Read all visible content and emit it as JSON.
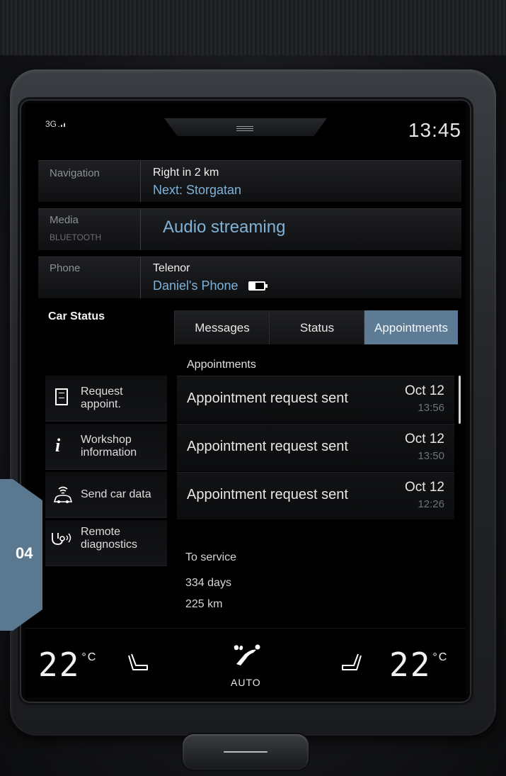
{
  "status_bar": {
    "signal": "3G",
    "clock": "13:45"
  },
  "navigation": {
    "label": "Navigation",
    "instruction": "Right in 2 km",
    "next": "Next: Storgatan"
  },
  "media": {
    "label": "Media",
    "source": "BLUETOOTH",
    "title": "Audio streaming"
  },
  "phone": {
    "label": "Phone",
    "carrier": "Telenor",
    "device": "Daniel's Phone"
  },
  "car_status": {
    "label": "Car Status",
    "tabs": [
      {
        "label": "Messages",
        "active": false
      },
      {
        "label": "Status",
        "active": false
      },
      {
        "label": "Appointments",
        "active": true
      }
    ],
    "section_title": "Appointments",
    "side_buttons": [
      {
        "label": "Request appoint.",
        "icon": "document-icon"
      },
      {
        "label": "Workshop information",
        "icon": "info-icon"
      },
      {
        "label": "Send car data",
        "icon": "car-data-icon"
      },
      {
        "label": "Remote diagnostics",
        "icon": "stethoscope-icon"
      }
    ],
    "appointments": [
      {
        "message": "Appointment request sent",
        "date": "Oct 12",
        "time": "13:56"
      },
      {
        "message": "Appointment request sent",
        "date": "Oct 12",
        "time": "13:50"
      },
      {
        "message": "Appointment request sent",
        "date": "Oct 12",
        "time": "12:26"
      }
    ],
    "service": {
      "label": "To service",
      "days": "334 days",
      "distance": "225 km"
    }
  },
  "climate": {
    "left_temp": "22",
    "right_temp": "22",
    "unit": "°C",
    "fan_mode": "AUTO"
  },
  "chapter": "04",
  "colors": {
    "accent": "#5d7b95",
    "link_blue": "#7fb2d8",
    "chapter_tab": "#5b7891"
  }
}
